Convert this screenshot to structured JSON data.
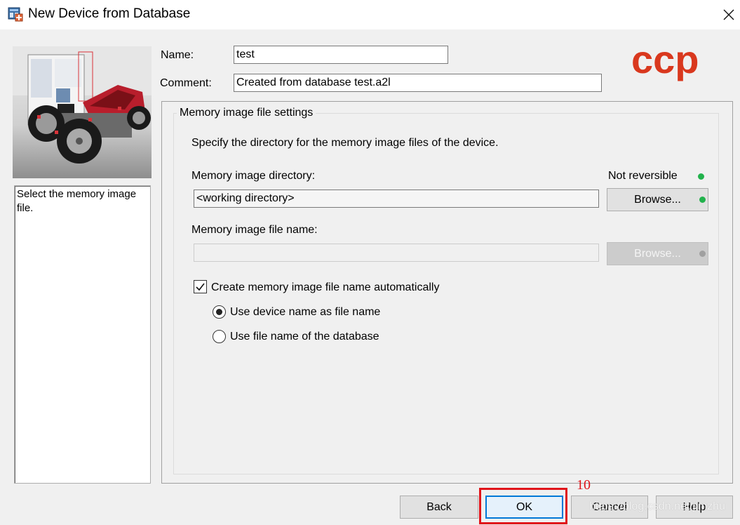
{
  "window": {
    "title": "New Device from Database"
  },
  "form": {
    "name_label": "Name:",
    "name_value": "test",
    "comment_label": "Comment:",
    "comment_value": "Created from database test.a2l"
  },
  "help": {
    "text": "Select the memory image file."
  },
  "logo": {
    "text": "ccp",
    "color": "#d9381e",
    "dark_color": "#555555"
  },
  "group": {
    "title": "Memory image file settings",
    "instruction": "Specify the directory for the memory image files of the device.",
    "dir_label": "Memory image directory:",
    "not_reversible_label": "Not reversible",
    "dir_value": "<working directory>",
    "browse_dir_label": "Browse...",
    "file_label": "Memory image file name:",
    "file_value": "",
    "browse_file_label": "Browse...",
    "auto_checkbox_label": "Create memory image file name automatically",
    "auto_checked": true,
    "radio_options": [
      {
        "label": "Use device name as file name",
        "selected": true
      },
      {
        "label": "Use file name of the database",
        "selected": false
      }
    ]
  },
  "footer": {
    "back_label": "Back",
    "ok_label": "OK",
    "cancel_label": "Cancel",
    "help_label": "Help"
  },
  "annotation": {
    "step_number": "10",
    "highlight_color": "#e0141a"
  },
  "watermark": {
    "text": "https://blog.csdn.net/jimzhu"
  },
  "colors": {
    "status_ok": "#22b24c",
    "status_disabled": "#a0a0a0"
  }
}
